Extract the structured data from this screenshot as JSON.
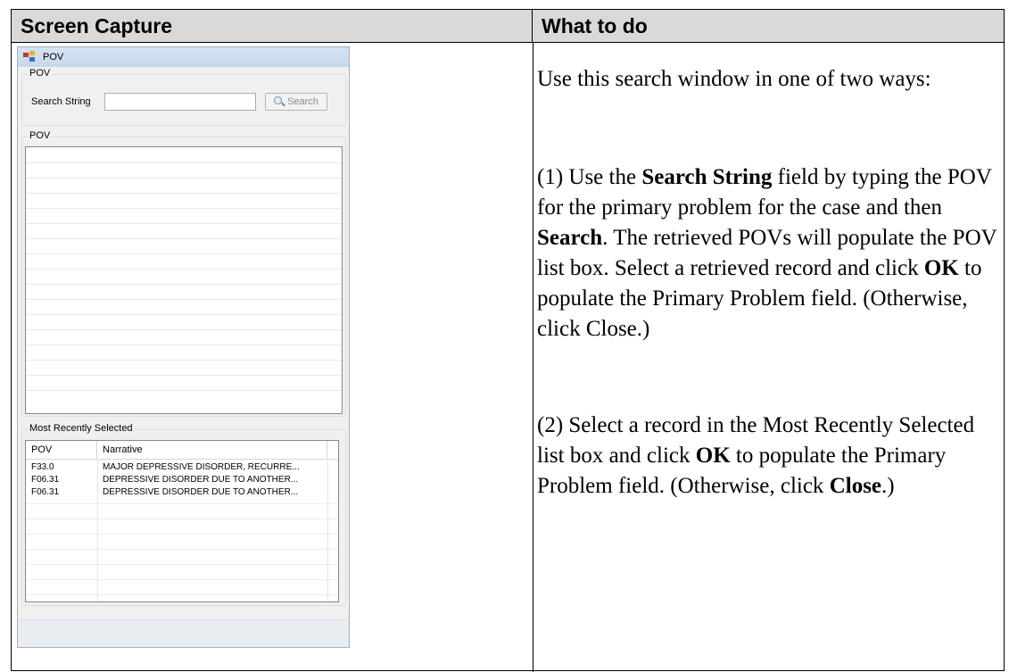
{
  "table": {
    "col1_header": "Screen Capture",
    "col2_header": "What to do"
  },
  "window": {
    "title": "POV",
    "group_pov_label": "POV",
    "search_label": "Search String",
    "search_value": "",
    "search_button": "Search",
    "list_group_label": "POV",
    "mrs_group_label": "Most Recently Selected",
    "mrs_columns": [
      "POV",
      "Narrative"
    ],
    "mrs_rows": [
      {
        "pov": "F33.0",
        "narrative": "MAJOR DEPRESSIVE DISORDER, RECURRE..."
      },
      {
        "pov": "F06.31",
        "narrative": "DEPRESSIVE DISORDER DUE TO ANOTHER..."
      },
      {
        "pov": "F06.31",
        "narrative": "DEPRESSIVE DISORDER DUE TO ANOTHER..."
      }
    ]
  },
  "instructions": {
    "intro": "Use this search window in one of two ways:",
    "p1_a": "(1) Use the ",
    "p1_b": "Search String",
    "p1_c": " field by typing the POV for the primary problem for the case and then ",
    "p1_d": "Search",
    "p1_e": ". The retrieved POVs will populate the POV list box. Select a retrieved record and click ",
    "p1_f": "OK",
    "p1_g": " to populate the Primary Problem field. (Otherwise, click Close.)",
    "p2_a": "(2) Select a record in the Most Recently Selected list box and click ",
    "p2_b": "OK",
    "p2_c": " to populate the Primary Problem field. (Otherwise, click ",
    "p2_d": "Close",
    "p2_e": ".)"
  }
}
